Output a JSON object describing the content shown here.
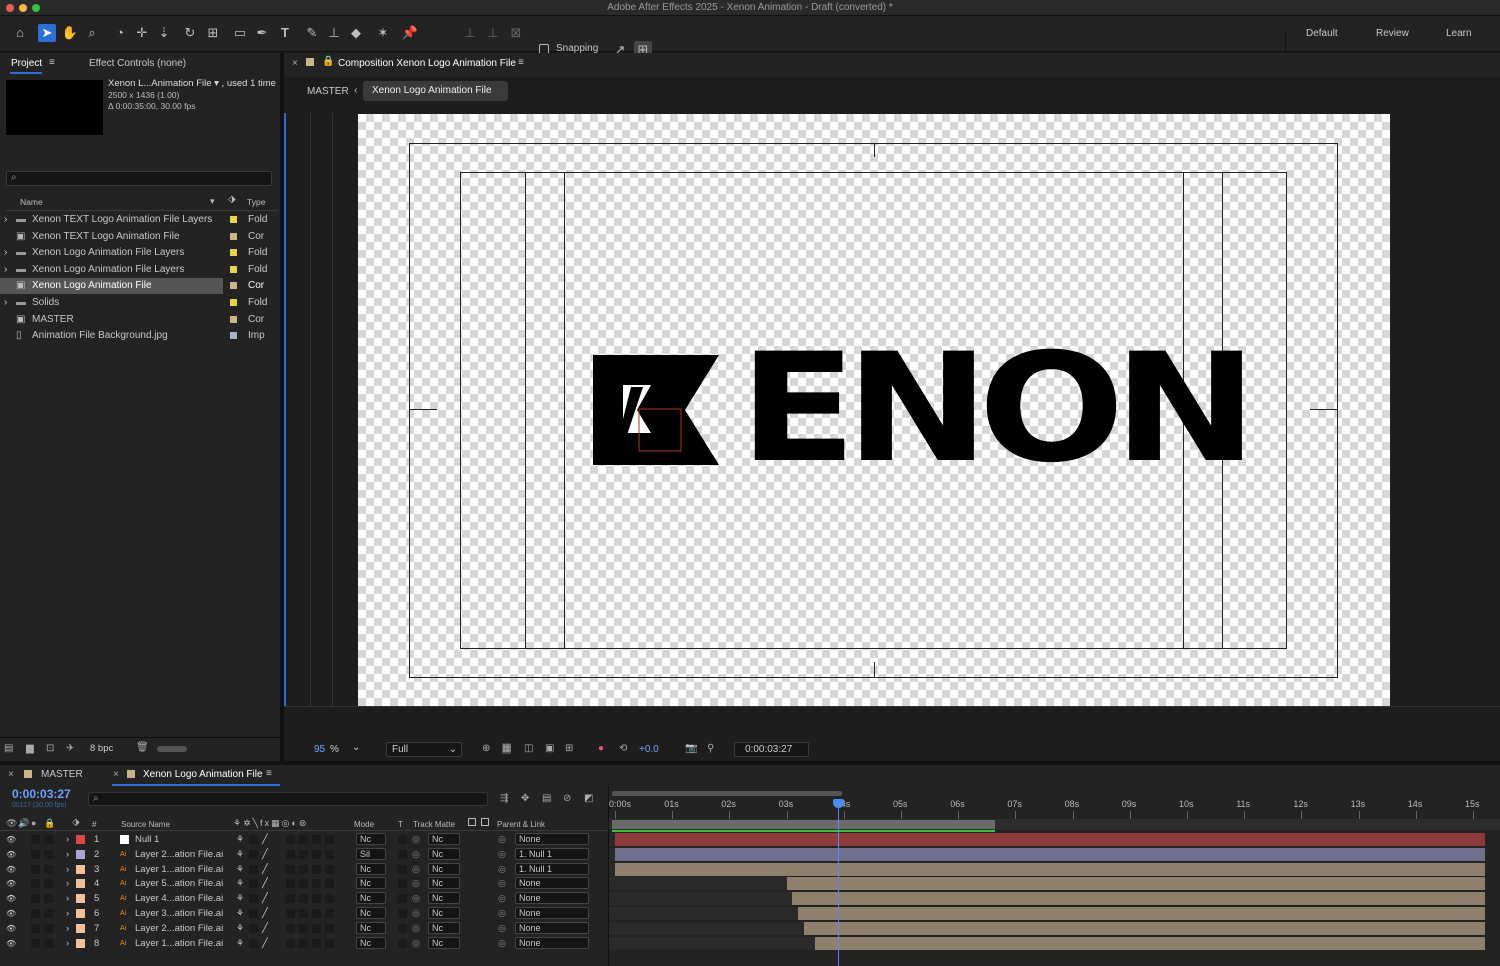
{
  "window": {
    "title": "Adobe After Effects 2025 - Xenon Animation - Draft (converted) *"
  },
  "toolbar": {
    "snapping_label": "Snapping",
    "workspaces": [
      "Default",
      "Review",
      "Learn"
    ]
  },
  "project_panel": {
    "tab_project": "Project",
    "tab_effect_controls": "Effect Controls (none)",
    "info_name": "Xenon L...Animation File ▾ , used 1 time",
    "info_size": "2500 x 1436 (1.00)",
    "info_duration": "Δ 0:00:35:00, 30.00 fps",
    "col_name": "Name",
    "col_type": "Type",
    "items": [
      {
        "name": "Xenon TEXT Logo Animation File Layers",
        "type": "Fold",
        "kind": "folder",
        "color": "#e8d24a",
        "selected": false
      },
      {
        "name": "Xenon TEXT Logo Animation File",
        "type": "Cor",
        "kind": "comp",
        "color": "#c9b48c",
        "selected": false
      },
      {
        "name": "Xenon Logo Animation File Layers",
        "type": "Fold",
        "kind": "folder",
        "color": "#e8d24a",
        "selected": false
      },
      {
        "name": "Xenon Logo Animation File Layers",
        "type": "Fold",
        "kind": "folder",
        "color": "#e8d24a",
        "selected": false
      },
      {
        "name": "Xenon Logo Animation File",
        "type": "Cor",
        "kind": "comp",
        "color": "#c9b48c",
        "selected": true
      },
      {
        "name": "Solids",
        "type": "Fold",
        "kind": "folder",
        "color": "#e8d24a",
        "selected": false
      },
      {
        "name": "MASTER",
        "type": "Cor",
        "kind": "comp",
        "color": "#c9b48c",
        "selected": false
      },
      {
        "name": "Animation File Background.jpg",
        "type": "Imp",
        "kind": "file",
        "color": "#a9b2cc",
        "selected": false
      }
    ],
    "bpc": "8 bpc"
  },
  "comp_panel": {
    "tab_title": "Composition Xenon Logo Animation File",
    "breadcrumb_master": "MASTER",
    "breadcrumb_current": "Xenon Logo Animation File",
    "zoom": "95",
    "zoom_unit": "%",
    "resolution": "Full",
    "exposure": "+0.0",
    "timecode": "0:00:03:27",
    "logo_text": "ENON"
  },
  "timeline": {
    "tab_master": "MASTER",
    "tab_current": "Xenon Logo Animation File",
    "timecode": "0:00:03:27",
    "frames": "00117 (30.00 fps)",
    "col_source": "Source Name",
    "col_mode": "Mode",
    "col_t": "T",
    "col_trackmatte": "Track Matte",
    "col_parent": "Parent & Link",
    "ruler_labels": [
      "0:00s",
      "01s",
      "02s",
      "03s",
      "04s",
      "05s",
      "06s",
      "07s",
      "08s",
      "09s",
      "10s",
      "11s",
      "12s",
      "13s",
      "14s",
      "15s"
    ],
    "playhead_seconds": 3.9,
    "work_area_end_seconds": 6.7,
    "layers": [
      {
        "num": "1",
        "name": "Null 1",
        "mode": "Nc",
        "matte": "Nc",
        "parent": "None",
        "label_color": "#e04848",
        "start_seconds": 0,
        "bar_color": "#8c3a3a",
        "icon": "null"
      },
      {
        "num": "2",
        "name": "Layer 2...ation File.ai",
        "mode": "Sil",
        "matte": "Nc",
        "parent": "1. Null 1",
        "label_color": "#a9a3d8",
        "start_seconds": 0,
        "bar_color": "#6f6e8c",
        "icon": "ai"
      },
      {
        "num": "3",
        "name": "Layer 1...ation File.ai",
        "mode": "Nc",
        "matte": "Nc",
        "parent": "1. Null 1",
        "label_color": "#f1c29a",
        "start_seconds": 0,
        "bar_color": "#8f7f6d",
        "icon": "ai"
      },
      {
        "num": "4",
        "name": "Layer 5...ation File.ai",
        "mode": "Nc",
        "matte": "Nc",
        "parent": "None",
        "label_color": "#f1c29a",
        "start_seconds": 3.0,
        "bar_color": "#8f7f6d",
        "icon": "ai"
      },
      {
        "num": "5",
        "name": "Layer 4...ation File.ai",
        "mode": "Nc",
        "matte": "Nc",
        "parent": "None",
        "label_color": "#f1c29a",
        "start_seconds": 3.1,
        "bar_color": "#8f7f6d",
        "icon": "ai"
      },
      {
        "num": "6",
        "name": "Layer 3...ation File.ai",
        "mode": "Nc",
        "matte": "Nc",
        "parent": "None",
        "label_color": "#f1c29a",
        "start_seconds": 3.2,
        "bar_color": "#8f7f6d",
        "icon": "ai"
      },
      {
        "num": "7",
        "name": "Layer 2...ation File.ai",
        "mode": "Nc",
        "matte": "Nc",
        "parent": "None",
        "label_color": "#f1c29a",
        "start_seconds": 3.3,
        "bar_color": "#8f7f6d",
        "icon": "ai"
      },
      {
        "num": "8",
        "name": "Layer 1...ation File.ai",
        "mode": "Nc",
        "matte": "Nc",
        "parent": "None",
        "label_color": "#f1c29a",
        "start_seconds": 3.5,
        "bar_color": "#8f7f6d",
        "icon": "ai"
      }
    ]
  }
}
